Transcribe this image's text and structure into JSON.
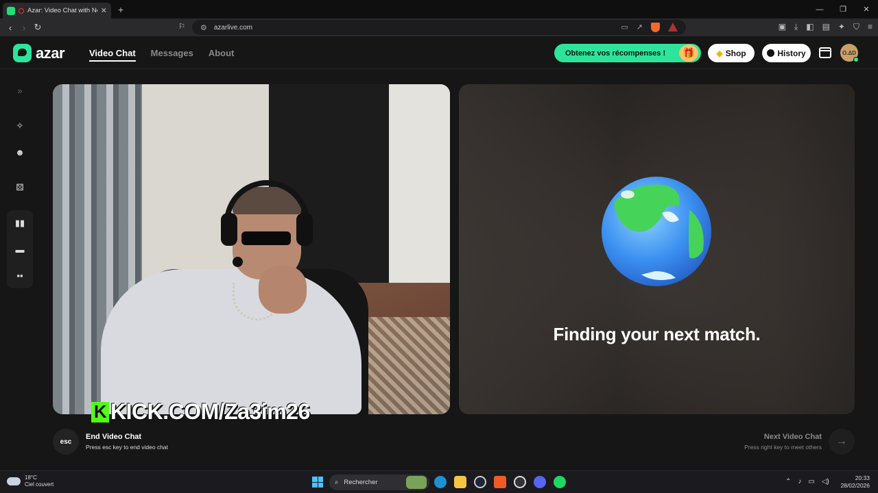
{
  "browser": {
    "tab_title": "Azar: Video Chat with New Pe",
    "url": "azarlive.com",
    "new_tab": "+",
    "tab_close": "✕"
  },
  "header": {
    "logo": "azar",
    "nav": [
      "Video Chat",
      "Messages",
      "About"
    ],
    "rewards_label": "Obtenez vos récompenses !",
    "shop_label": "Shop",
    "history_label": "History",
    "avatar_text": "O.ΔD"
  },
  "left_video": {
    "overlay_text": "KICK.COM/Za3im26",
    "overlay_icon": "K"
  },
  "right_video": {
    "status": "Finding your next match."
  },
  "controls": {
    "esc_label": "esc",
    "end_title": "End Video Chat",
    "end_sub": "Press esc key to end video chat",
    "next_title": "Next Video Chat",
    "next_sub": "Press right key to meet others"
  },
  "taskbar": {
    "temp": "18°C",
    "weather": "Ciel couvert",
    "search": "Rechercher",
    "time": "20:33",
    "date": "28/02/2026"
  },
  "colors": {
    "accent": "#2ce59b",
    "kick_green": "#53fc18"
  }
}
